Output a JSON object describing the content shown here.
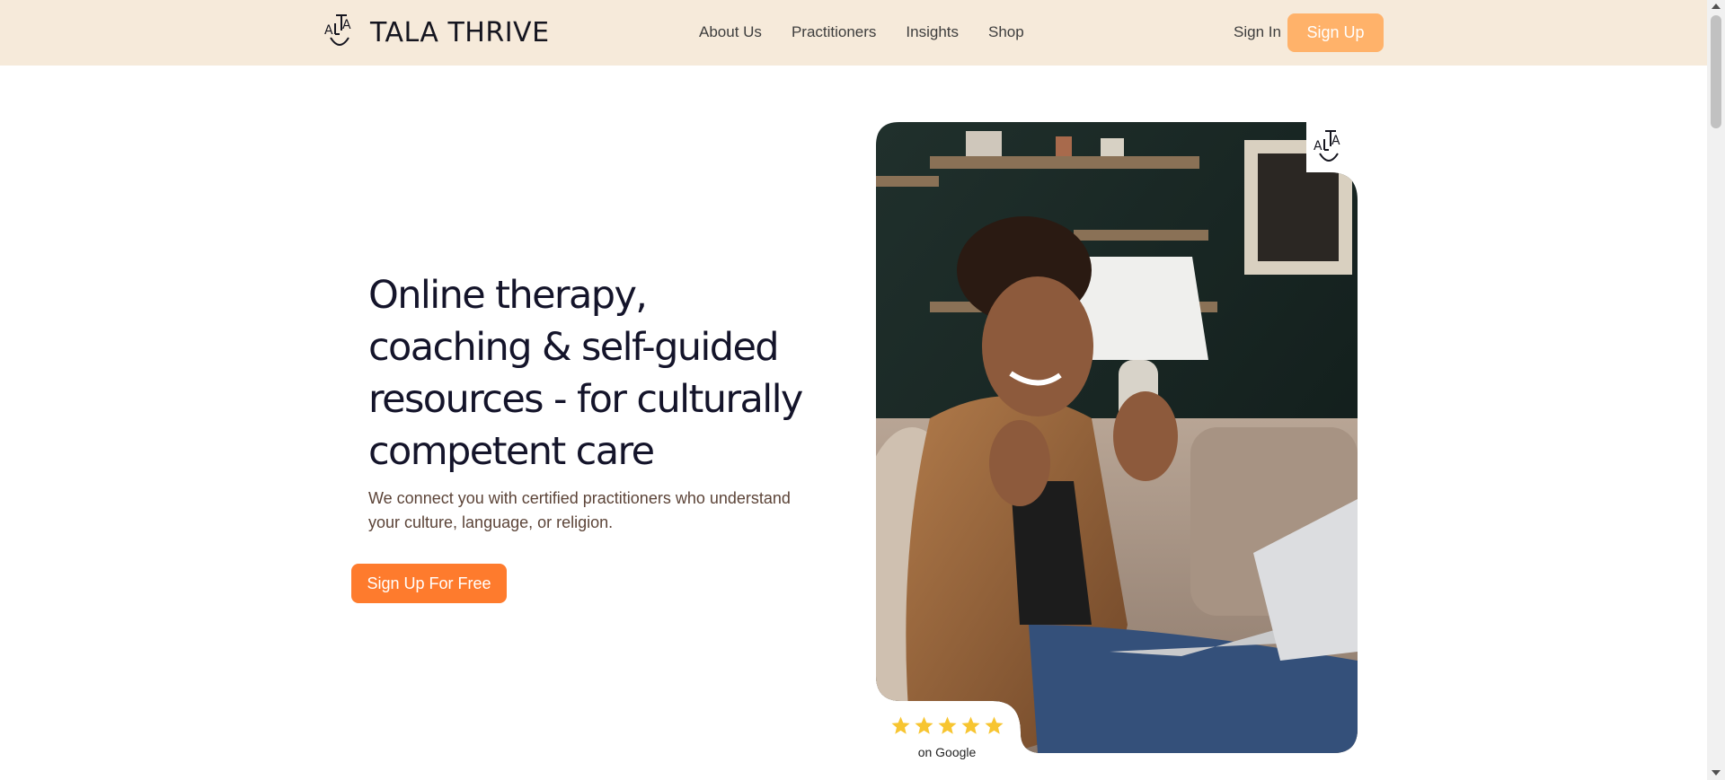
{
  "brand": {
    "name": "TALA THRIVE",
    "logo_icon": "tala-logo-icon"
  },
  "nav": {
    "items": [
      {
        "label": "About Us"
      },
      {
        "label": "Practitioners"
      },
      {
        "label": "Insights"
      },
      {
        "label": "Shop"
      }
    ],
    "sign_in": "Sign In",
    "sign_up": "Sign Up"
  },
  "hero": {
    "title_lines": [
      "Online therapy,",
      "coaching & self-guided",
      "resources - for culturally",
      "competent care"
    ],
    "subtitle": "We connect you with certified practitioners who understand your culture, language, or religion.",
    "cta": "Sign Up For Free"
  },
  "rating": {
    "stars": 5,
    "text": "on Google"
  },
  "colors": {
    "header_bg": "#f6eada",
    "sign_up_bg": "#ffb26a",
    "cta_bg": "#fe7b2d",
    "star": "#f7c531",
    "title": "#14142a",
    "subtitle": "#5c4438"
  }
}
